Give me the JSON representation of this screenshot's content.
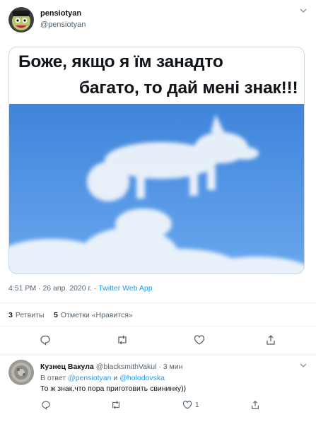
{
  "tweet": {
    "display_name": "pensiotyan",
    "handle": "@pensiotyan",
    "image_caption_line1": "Боже, якщо я їм занадто",
    "image_caption_line2": "багато, то дай мені знак!!!",
    "time": "4:51 PM",
    "date": "26 апр. 2020 г.",
    "source": "Twitter Web App",
    "retweets_count": "3",
    "retweets_label": "Ретвиты",
    "likes_count": "5",
    "likes_label": "Отметки «Нравится»"
  },
  "reply": {
    "display_name": "Кузнец Вакула",
    "handle": "@blacksmithVakul",
    "time_ago": "3 мин",
    "reply_prefix": "В ответ",
    "reply_user1": "@pensiotyan",
    "reply_and": "и",
    "reply_user2": "@holodovska",
    "text": "То ж знак,что пора приготовить свининку))",
    "like_count": "1"
  },
  "colors": {
    "link": "#1d9bf0",
    "secondary_text": "#536471",
    "sky": "#4a90e0"
  }
}
